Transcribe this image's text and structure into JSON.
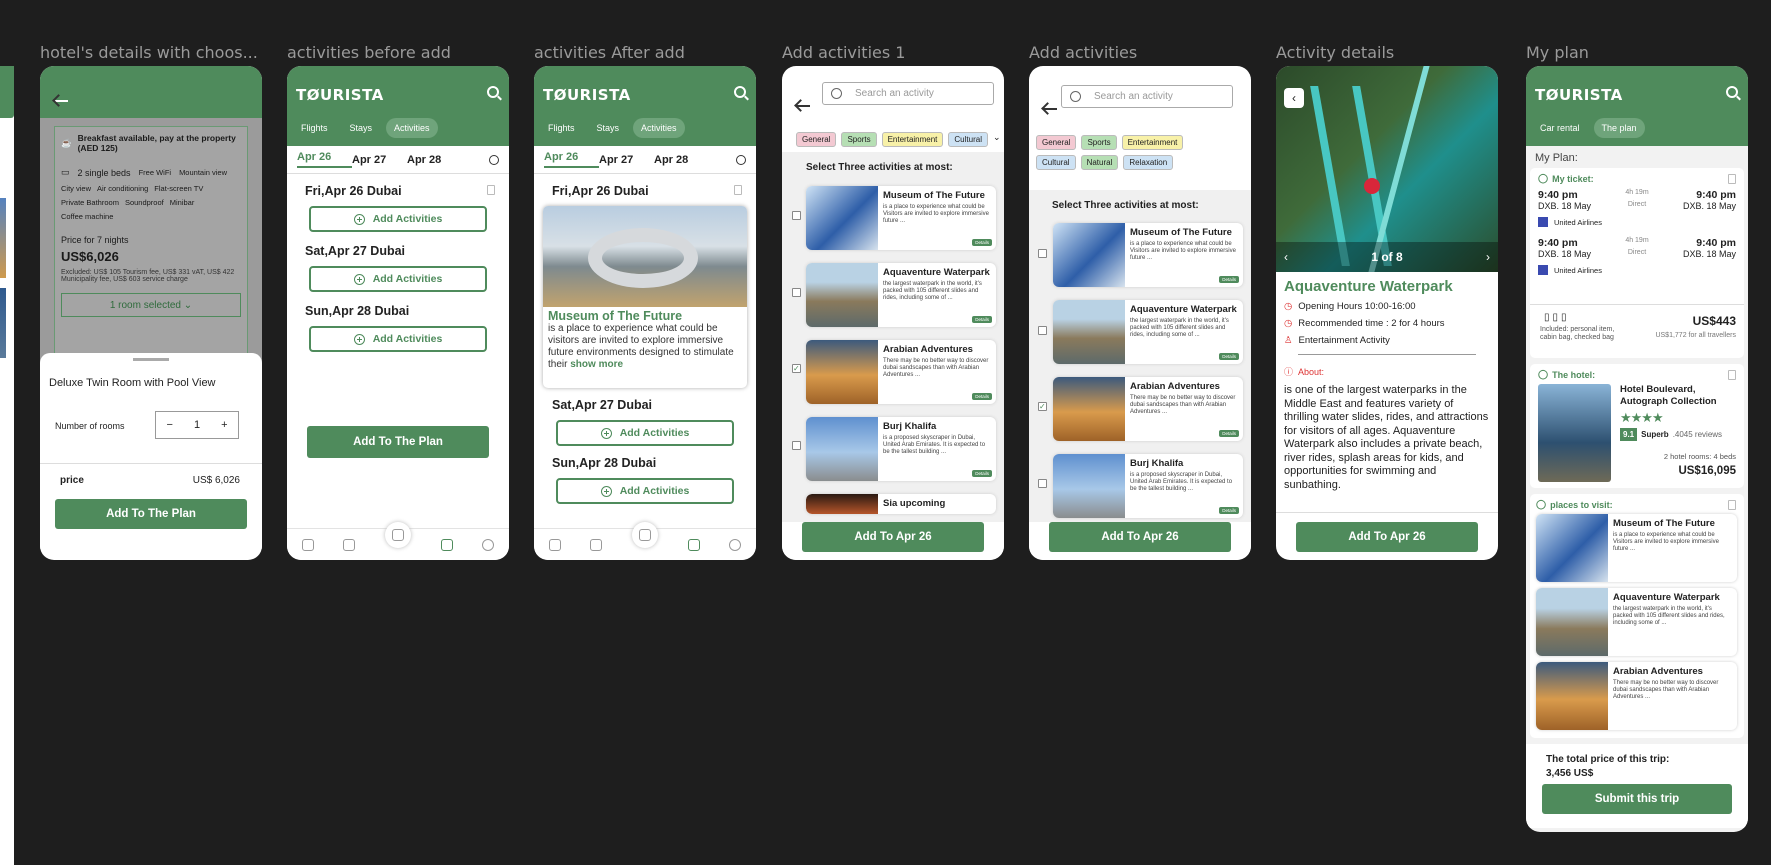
{
  "labels": [
    "hotel's details with choos...",
    "activities before add",
    "activities After add",
    "Add activities 1",
    "Add activities",
    "Activity details",
    "My plan"
  ],
  "brand": "TØURISTA",
  "tabs_trip": [
    "Flights",
    "Stays",
    "Activities"
  ],
  "tabs_plan": [
    "Car rental",
    "The plan"
  ],
  "dates": [
    "Apr 26",
    "Apr 27",
    "Apr 28"
  ],
  "days": [
    "Fri,Apr 26 Dubai",
    "Sat,Apr 27 Dubai",
    "Sun,Apr 28 Dubai"
  ],
  "add_activities": "Add Activities",
  "add_to_plan": "Add To The Plan",
  "add_to_apr": "Add To Apr 26",
  "hotel": {
    "breakfast": "Breakfast available, pay at the property (AED 125)",
    "beds": "2 single beds",
    "wifi": "Free WiFi",
    "view": "Mountain view",
    "city": "City view",
    "ac": "Air conditioning",
    "tv": "Flat-screen TV",
    "bath": "Private Bathroom",
    "sound": "Soundproof",
    "minibar": "Minibar",
    "coffee": "Coffee machine",
    "price_label": "Price for 7 nights",
    "price": "US$6,026",
    "excluded": "Excluded: US$ 105 Tourism fee, US$ 331 vAT, US$ 422 Municipality fee, US$ 603 service charge",
    "room_selected": "1 room selected",
    "room_name": "Deluxe Twin Room with Pool View",
    "rooms_label": "Number of rooms",
    "rooms_count": "1",
    "price_row": "price",
    "price_row_val": "US$ 6,026"
  },
  "museum_feature": {
    "title": "Museum of The Future",
    "desc": "is a place to experience what could be visitors are invited to explore immersive future environments designed to stimulate their",
    "more": "show more"
  },
  "search_placeholder": "Search an activity",
  "chips": [
    "General",
    "Sports",
    "Entertainment",
    "Cultural"
  ],
  "chips2": [
    "General",
    "Sports",
    "Entertainment",
    "Cultural",
    "Natural",
    "Relaxation"
  ],
  "select_title": "Select Three activities at most:",
  "details": "Details",
  "activities": [
    {
      "title": "Museum of The Future",
      "desc": "is a place to experience what could be Visitors are invited to explore immersive future ..."
    },
    {
      "title": "Aquaventure Waterpark",
      "desc": "the largest waterpark in the world, it's packed with 105 different slides and rides, including some of ..."
    },
    {
      "title": "Arabian Adventures",
      "desc": "There may be no better way to discover dubai sandscapes than with Arabian Adventures ..."
    },
    {
      "title": "Burj Khalifa",
      "desc": "is a proposed skyscraper in Dubai, United Arab Emirates. It is expected to be the tallest building ..."
    },
    {
      "title": "Sia upcoming",
      "desc": ""
    }
  ],
  "activity_detail": {
    "counter": "1 of 8",
    "title": "Aquaventure Waterpark",
    "hours": "Opening Hours 10:00-16:00",
    "recommended": "Recommended time : 2 for 4 hours",
    "category": "Entertainment Activity",
    "about": "About:",
    "about_text": "is one of the largest waterparks in the Middle East and features variety of thrilling water slides, rides, and attractions for visitors of all ages. Aquaventure Waterpark also includes a private beach, river rides, splash areas for kids, and opportunities for swimming and sunbathing."
  },
  "plan": {
    "heading": "My Plan:",
    "ticket": "My ticket:",
    "flights": [
      {
        "dep": "9:40 pm",
        "arr": "9:40 pm",
        "dur": "4h 19m",
        "type": "Direct",
        "from": "DXB. 18 May",
        "to": "DXB. 18 May",
        "airline": "United Airlines"
      },
      {
        "dep": "9:40 pm",
        "arr": "9:40 pm",
        "dur": "4h 19m",
        "type": "Direct",
        "from": "DXB. 18 May",
        "to": "DXB. 18 May",
        "airline": "United Airlines"
      }
    ],
    "included": "Included: personal item, cabin bag, checked bag",
    "flight_price": "US$443",
    "flight_price_note": "US$1,772 for all travellers",
    "hotel_label": "The hotel:",
    "hotel_name": "Hotel Boulevard, Autograph Collection",
    "score": "9.1",
    "score_text": "Superb",
    "reviews": ".4045 reviews",
    "rooms": "2 hotel rooms: 4 beds",
    "hotel_price": "US$16,095",
    "places_label": "places to visit:",
    "total_label": "The total price of this trip:",
    "total": "3,456 US$",
    "submit": "Submit this trip"
  }
}
